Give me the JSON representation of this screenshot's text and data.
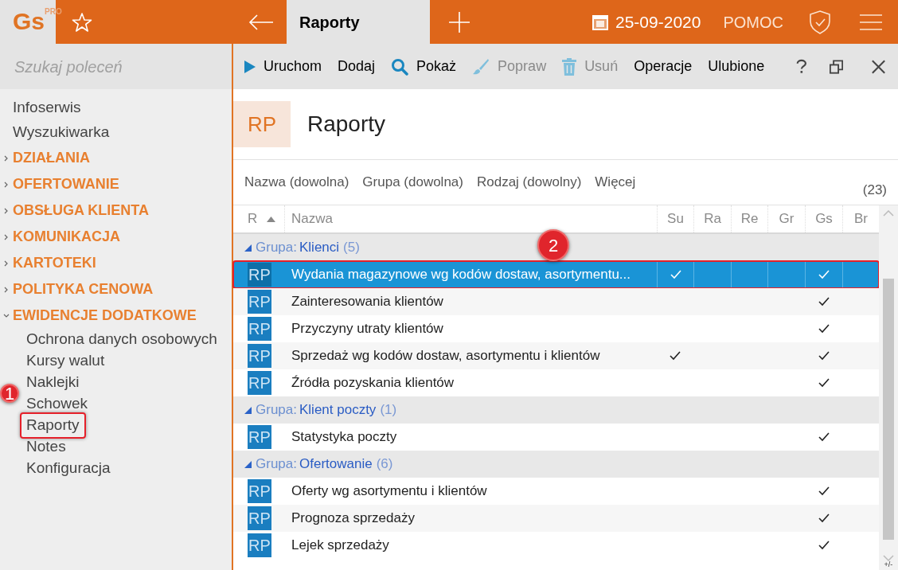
{
  "logo": {
    "text": "Gs",
    "badge": "PRO"
  },
  "topbar": {
    "tab": "Raporty",
    "date": "25-09-2020",
    "help": "POMOC"
  },
  "sidebar": {
    "search_placeholder": "Szukaj poleceń",
    "items": [
      {
        "kind": "link",
        "label": "Infoserwis"
      },
      {
        "kind": "link",
        "label": "Wyszukiwarka"
      },
      {
        "kind": "category",
        "label": "DZIAŁANIA",
        "expanded": false
      },
      {
        "kind": "category",
        "label": "OFERTOWANIE",
        "expanded": false
      },
      {
        "kind": "category",
        "label": "OBSŁUGA KLIENTA",
        "expanded": false
      },
      {
        "kind": "category",
        "label": "KOMUNIKACJA",
        "expanded": false
      },
      {
        "kind": "category",
        "label": "KARTOTEKI",
        "expanded": false
      },
      {
        "kind": "category",
        "label": "POLITYKA CENOWA",
        "expanded": false
      },
      {
        "kind": "category",
        "label": "EWIDENCJE DODATKOWE",
        "expanded": true,
        "children": [
          {
            "label": "Ochrona danych osobowych",
            "boxed": false
          },
          {
            "label": "Kursy walut",
            "boxed": false
          },
          {
            "label": "Naklejki",
            "boxed": false
          },
          {
            "label": "Schowek",
            "boxed": false
          },
          {
            "label": "Raporty",
            "boxed": true
          },
          {
            "label": "Notes",
            "boxed": false
          },
          {
            "label": "Konfiguracja",
            "boxed": false
          }
        ]
      }
    ]
  },
  "toolbar": [
    {
      "kind": "run",
      "label": "Uruchom",
      "disabled": false
    },
    {
      "kind": "text",
      "label": "Dodaj",
      "disabled": false
    },
    {
      "kind": "search",
      "label": "Pokaż",
      "disabled": false
    },
    {
      "kind": "brush",
      "label": "Popraw",
      "disabled": true
    },
    {
      "kind": "trash",
      "label": "Usuń",
      "disabled": true
    },
    {
      "kind": "text",
      "label": "Operacje",
      "disabled": false
    },
    {
      "kind": "text",
      "label": "Ulubione",
      "disabled": false
    }
  ],
  "header": {
    "badge": "RP",
    "title": "Raporty"
  },
  "filters": [
    "Nazwa (dowolna)",
    "Grupa (dowolna)",
    "Rodzaj (dowolny)",
    "Więcej"
  ],
  "count": "(23)",
  "table": {
    "columns": [
      "R",
      "Nazwa",
      "Su",
      "Ra",
      "Re",
      "Gr",
      "Gs",
      "Br"
    ],
    "groups": [
      {
        "prefix": "Grupa:",
        "name": "Klienci",
        "count": "(5)",
        "expanded": true,
        "rows": [
          {
            "icon": "RP",
            "name": "Wydania magazynowe wg kodów dostaw, asortymentu...",
            "selected": true,
            "marks": [
              true,
              false,
              false,
              false,
              true,
              false
            ]
          },
          {
            "icon": "RP",
            "name": "Zainteresowania klientów",
            "selected": false,
            "marks": [
              false,
              false,
              false,
              false,
              true,
              false
            ]
          },
          {
            "icon": "RP",
            "name": "Przyczyny utraty klientów",
            "selected": false,
            "marks": [
              false,
              false,
              false,
              false,
              true,
              false
            ]
          },
          {
            "icon": "RP",
            "name": "Sprzedaż wg kodów dostaw, asortymentu i klientów",
            "selected": false,
            "marks": [
              true,
              false,
              false,
              false,
              true,
              false
            ]
          },
          {
            "icon": "RP",
            "name": "Źródła pozyskania klientów",
            "selected": false,
            "marks": [
              false,
              false,
              false,
              false,
              true,
              false
            ]
          }
        ]
      },
      {
        "prefix": "Grupa:",
        "name": "Klient poczty",
        "count": "(1)",
        "expanded": true,
        "rows": [
          {
            "icon": "RP",
            "name": "Statystyka poczty",
            "selected": false,
            "marks": [
              false,
              false,
              false,
              false,
              true,
              false
            ]
          }
        ]
      },
      {
        "prefix": "Grupa:",
        "name": "Ofertowanie",
        "count": "(6)",
        "expanded": true,
        "rows": [
          {
            "icon": "RP",
            "name": "Oferty wg asortymentu i klientów",
            "selected": false,
            "marks": [
              false,
              false,
              false,
              false,
              true,
              false
            ]
          },
          {
            "icon": "RP",
            "name": "Prognoza sprzedaży",
            "selected": false,
            "marks": [
              false,
              false,
              false,
              false,
              true,
              false
            ]
          },
          {
            "icon": "RP",
            "name": "Lejek sprzedaży",
            "selected": false,
            "marks": [
              false,
              false,
              false,
              false,
              true,
              false
            ]
          }
        ]
      }
    ]
  },
  "scroll_hint": "+/-",
  "annotations": [
    "1",
    "2"
  ]
}
